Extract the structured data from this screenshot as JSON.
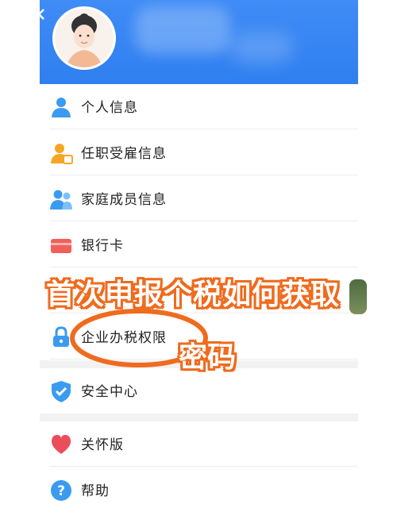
{
  "colors": {
    "header": "#2f7ff0",
    "accent_blue": "#3a9bf0",
    "overlay_orange": "#ef6b1e"
  },
  "menu": {
    "items": [
      {
        "label": "个人信息",
        "icon": "person-icon"
      },
      {
        "label": "任职受雇信息",
        "icon": "employment-icon"
      },
      {
        "label": "家庭成员信息",
        "icon": "family-icon"
      },
      {
        "label": "银行卡",
        "icon": "bank-card-icon"
      },
      {
        "label": "",
        "icon": "lock-icon"
      },
      {
        "label": "企业办税权限",
        "icon": "lock-icon"
      },
      {
        "label": "安全中心",
        "icon": "shield-icon"
      },
      {
        "label": "关怀版",
        "icon": "heart-icon"
      },
      {
        "label": "帮助",
        "icon": "help-icon"
      }
    ]
  },
  "overlay": {
    "line1": "首次申报个税如何获取",
    "line2": "密码"
  }
}
